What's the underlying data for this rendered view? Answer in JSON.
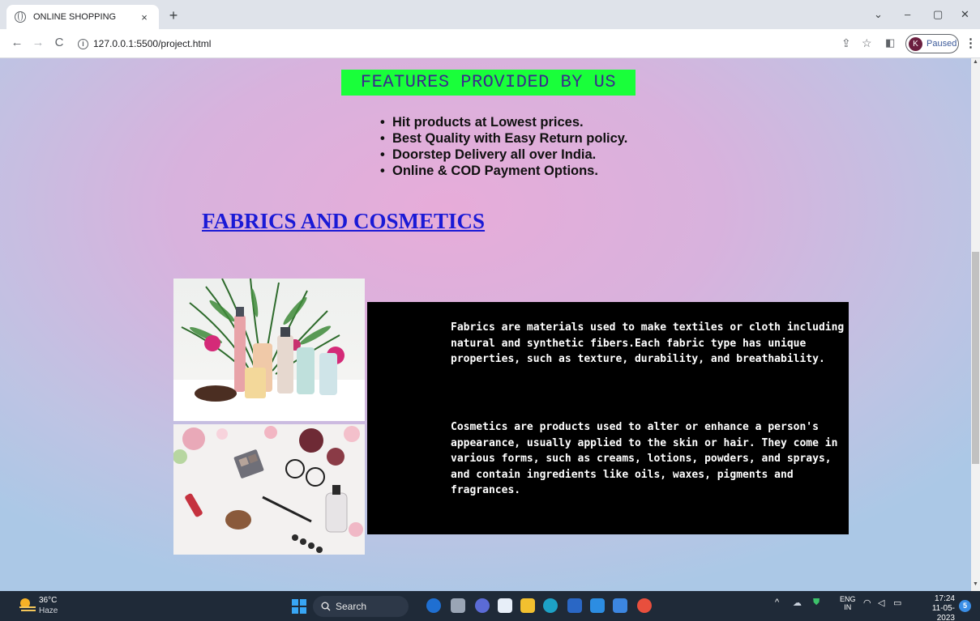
{
  "browser": {
    "tab_title": "ONLINE SHOPPING",
    "tab_close": "×",
    "new_tab": "+",
    "url": "127.0.0.1:5500/project.html",
    "profile_initial": "K",
    "profile_status": "Paused",
    "window_controls": [
      "⌄",
      "–",
      "▢",
      "✕"
    ]
  },
  "page": {
    "features_title": "FEATURES PROVIDED BY US",
    "features": [
      "Hit products at Lowest prices.",
      "Best Quality with Easy Return policy.",
      "Doorstep Delivery all over India.",
      "Online & COD Payment Options."
    ],
    "section_link": "FABRICS AND COSMETICS",
    "description": [
      "Fabrics are materials used to make textiles or cloth including natural and synthetic fibers.Each fabric type has unique properties, such as texture, durability, and breathability.",
      "Cosmetics are products used to alter or enhance a person's appearance, usually applied to the skin or hair. They come in various forms, such as creams, lotions, powders, and sprays, and contain ingredients like oils, waxes, pigments and fragrances."
    ],
    "images": [
      "cosmetics-products-image",
      "makeup-flatlay-image"
    ]
  },
  "taskbar": {
    "weather_temp": "36°C",
    "weather_condition": "Haze",
    "search_placeholder": "Search",
    "lang_top": "ENG",
    "lang_bottom": "IN",
    "time": "17:24",
    "date": "11-05-2023",
    "notification_count": "5"
  },
  "colors": {
    "features_bg": "#19ff3a",
    "features_text": "#3a2a8c",
    "link": "#1a1ad6",
    "desc_bg": "#000000",
    "desc_text": "#ffffff"
  }
}
